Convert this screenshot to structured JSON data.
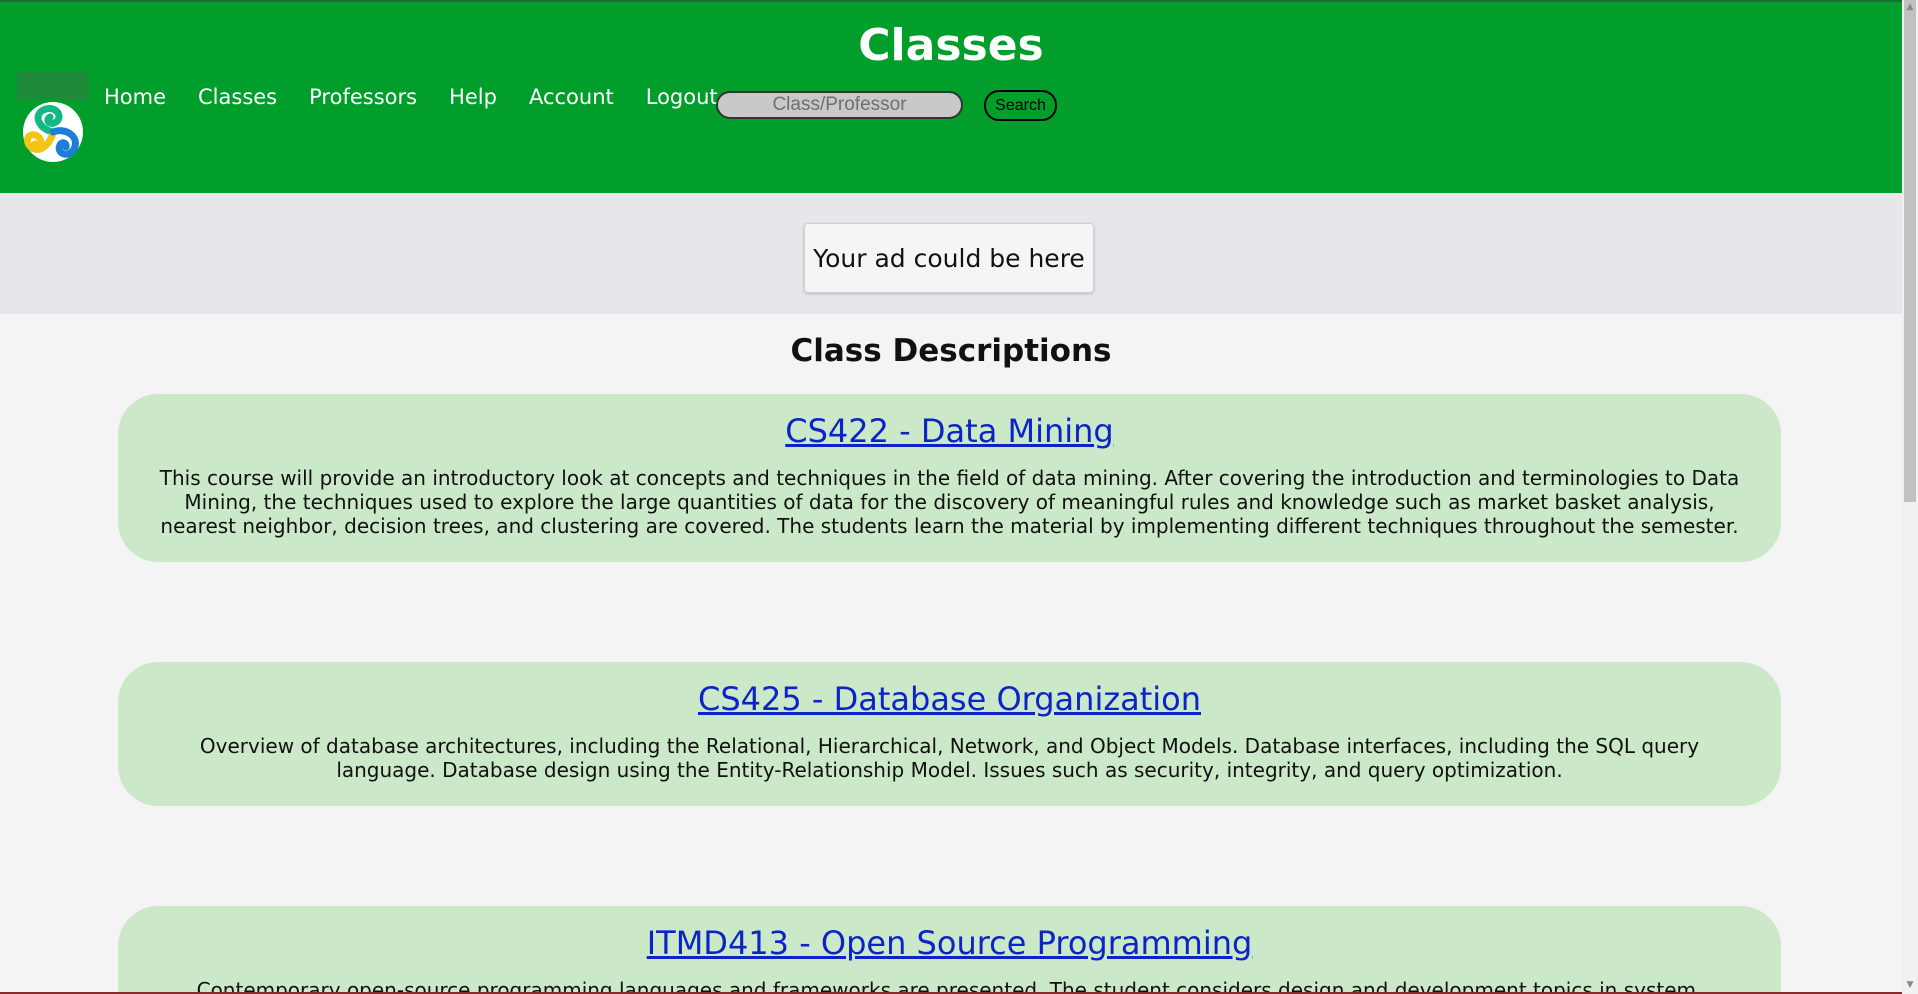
{
  "header": {
    "title": "Classes",
    "nav": [
      "Home",
      "Classes",
      "Professors",
      "Help",
      "Account",
      "Logout"
    ],
    "search_placeholder": "Class/Professor",
    "search_button": "Search",
    "logo_icon": "swirl-logo-icon"
  },
  "ad": {
    "text": "Your ad could be here"
  },
  "main": {
    "section_title": "Class Descriptions",
    "courses": [
      {
        "title": "CS422 - Data Mining",
        "description": "This course will provide an introductory look at concepts and techniques in the field of data mining. After covering the introduction and terminologies to Data Mining, the techniques used to explore the large quantities of data for the discovery of meaningful rules and knowledge such as market basket analysis, nearest neighbor, decision trees, and clustering are covered. The students learn the material by implementing different techniques throughout the semester."
      },
      {
        "title": "CS425 - Database Organization",
        "description": "Overview of database architectures, including the Relational, Hierarchical, Network, and Object Models. Database interfaces, including the SQL query language. Database design using the Entity-Relationship Model. Issues such as security, integrity, and query optimization."
      },
      {
        "title": "ITMD413 - Open Source Programming",
        "description": "Contemporary open-source programming languages and frameworks are presented. The student considers design and development topics in system, graphical user"
      }
    ]
  },
  "colors": {
    "header_bg": "#029e2b",
    "card_bg": "#cbe8c8",
    "link": "#0b24c7",
    "ad_band": "#e7e6eb"
  }
}
